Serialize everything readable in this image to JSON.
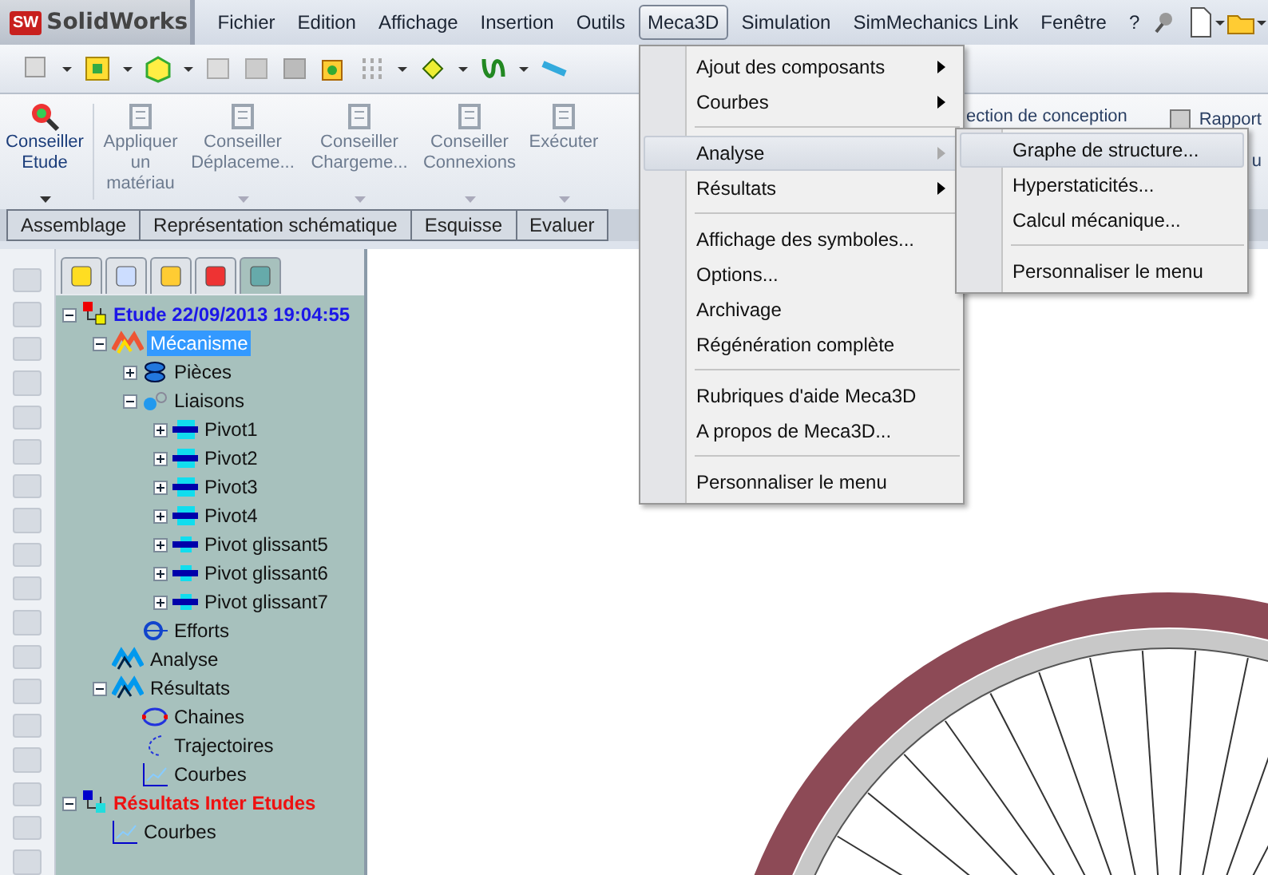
{
  "app": {
    "logo_badge": "SW",
    "logo_text": "SolidWorks"
  },
  "menubar": [
    {
      "label": "Fichier",
      "selected": false
    },
    {
      "label": "Edition",
      "selected": false
    },
    {
      "label": "Affichage",
      "selected": false
    },
    {
      "label": "Insertion",
      "selected": false
    },
    {
      "label": "Outils",
      "selected": false
    },
    {
      "label": "Meca3D",
      "selected": true
    },
    {
      "label": "Simulation",
      "selected": false
    },
    {
      "label": "SimMechanics Link",
      "selected": false
    },
    {
      "label": "Fenêtre",
      "selected": false
    },
    {
      "label": "?",
      "selected": false
    }
  ],
  "ribbon": [
    {
      "label": "Conseiller Etude",
      "disabled": false,
      "dropdown": true
    },
    {
      "label": "Appliquer un matériau",
      "disabled": true,
      "dropdown": false
    },
    {
      "label": "Conseiller Déplaceme...",
      "disabled": true,
      "dropdown": true
    },
    {
      "label": "Conseiller Chargeme...",
      "disabled": true,
      "dropdown": true
    },
    {
      "label": "Conseiller Connexions",
      "disabled": true,
      "dropdown": true
    },
    {
      "label": "Exécuter",
      "disabled": true,
      "dropdown": true
    }
  ],
  "ribbon_hidden_texts": {
    "design": "ection de conception",
    "report": "Rapport",
    "cut": "u"
  },
  "ribbon_tabs": [
    {
      "label": "Assemblage",
      "selected": false
    },
    {
      "label": "Représentation schématique",
      "selected": false
    },
    {
      "label": "Esquisse",
      "selected": false
    },
    {
      "label": "Evaluer",
      "selected": false
    }
  ],
  "tree_tabs": [
    {
      "selected": false
    },
    {
      "selected": false
    },
    {
      "selected": false
    },
    {
      "selected": false
    },
    {
      "selected": true
    }
  ],
  "tree": [
    {
      "label": "Etude 22/09/2013 19:04:55",
      "kind": "study",
      "expanded": true,
      "selected": false,
      "children": [
        {
          "label": "Mécanisme",
          "kind": "mecha",
          "expanded": true,
          "selected": true,
          "children": [
            {
              "label": "Pièces",
              "kind": "parts",
              "expanded": false,
              "selected": false
            },
            {
              "label": "Liaisons",
              "kind": "joints",
              "expanded": true,
              "selected": false,
              "children": [
                {
                  "label": "Pivot1",
                  "kind": "pivot",
                  "expanded": false,
                  "selected": false
                },
                {
                  "label": "Pivot2",
                  "kind": "pivot",
                  "expanded": false,
                  "selected": false
                },
                {
                  "label": "Pivot3",
                  "kind": "pivot",
                  "expanded": false,
                  "selected": false
                },
                {
                  "label": "Pivot4",
                  "kind": "pivot",
                  "expanded": false,
                  "selected": false
                },
                {
                  "label": "Pivot glissant5",
                  "kind": "slide",
                  "expanded": false,
                  "selected": false
                },
                {
                  "label": "Pivot glissant6",
                  "kind": "slide",
                  "expanded": false,
                  "selected": false
                },
                {
                  "label": "Pivot glissant7",
                  "kind": "slide",
                  "expanded": false,
                  "selected": false
                }
              ]
            },
            {
              "label": "Efforts",
              "kind": "forces",
              "selected": false
            }
          ]
        },
        {
          "label": "Analyse",
          "kind": "analysis",
          "selected": false
        },
        {
          "label": "Résultats",
          "kind": "analysis",
          "expanded": true,
          "selected": false,
          "children": [
            {
              "label": "Chaines",
              "kind": "chain",
              "selected": false
            },
            {
              "label": "Trajectoires",
              "kind": "traj",
              "selected": false
            },
            {
              "label": "Courbes",
              "kind": "curve",
              "selected": false
            }
          ]
        }
      ]
    },
    {
      "label": "Résultats Inter Etudes",
      "kind": "inter",
      "expanded": true,
      "selected": false,
      "children": [
        {
          "label": "Courbes",
          "kind": "curve",
          "selected": false
        }
      ]
    }
  ],
  "menu": [
    {
      "kind": "submenu",
      "label": "Ajout des composants",
      "selected": false
    },
    {
      "kind": "submenu",
      "label": "Courbes",
      "selected": false
    },
    {
      "kind": "separator"
    },
    {
      "kind": "submenu",
      "label": "Analyse",
      "selected": true
    },
    {
      "kind": "submenu",
      "label": "Résultats",
      "selected": false
    },
    {
      "kind": "separator"
    },
    {
      "kind": "item",
      "label": "Affichage des symboles...",
      "selected": false
    },
    {
      "kind": "item",
      "label": "Options...",
      "selected": false
    },
    {
      "kind": "item",
      "label": "Archivage",
      "selected": false
    },
    {
      "kind": "item",
      "label": "Régénération complète",
      "selected": false
    },
    {
      "kind": "separator"
    },
    {
      "kind": "item",
      "label": "Rubriques d'aide Meca3D",
      "selected": false
    },
    {
      "kind": "item",
      "label": "A propos de Meca3D...",
      "selected": false
    },
    {
      "kind": "separator"
    },
    {
      "kind": "item",
      "label": "Personnaliser le menu",
      "selected": false
    }
  ],
  "submenu": [
    {
      "kind": "item",
      "label": "Graphe de structure...",
      "selected": true
    },
    {
      "kind": "item",
      "label": "Hyperstaticités...",
      "selected": false
    },
    {
      "kind": "item",
      "label": "Calcul mécanique...",
      "selected": false
    },
    {
      "kind": "separator"
    },
    {
      "kind": "item",
      "label": "Personnaliser le menu",
      "selected": false
    }
  ]
}
